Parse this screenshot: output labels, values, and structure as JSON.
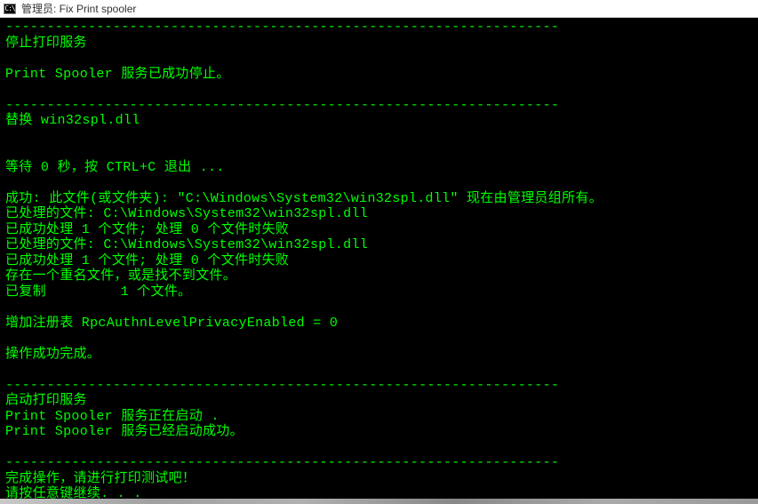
{
  "titlebar": {
    "icon_text": "C:\\",
    "title": "管理员:  Fix Print spooler"
  },
  "console": {
    "lines": [
      "-------------------------------------------------------------------",
      "停止打印服务",
      "",
      "Print Spooler 服务已成功停止。",
      "",
      "-------------------------------------------------------------------",
      "替换 win32spl.dll",
      "",
      "",
      "等待 0 秒，按 CTRL+C 退出 ...",
      "",
      "成功: 此文件(或文件夹): \"C:\\Windows\\System32\\win32spl.dll\" 现在由管理员组所有。",
      "已处理的文件: C:\\Windows\\System32\\win32spl.dll",
      "已成功处理 1 个文件; 处理 0 个文件时失败",
      "已处理的文件: C:\\Windows\\System32\\win32spl.dll",
      "已成功处理 1 个文件; 处理 0 个文件时失败",
      "存在一个重名文件，或是找不到文件。",
      "已复制         1 个文件。",
      "",
      "增加注册表 RpcAuthnLevelPrivacyEnabled = 0",
      "",
      "操作成功完成。",
      "",
      "-------------------------------------------------------------------",
      "启动打印服务",
      "Print Spooler 服务正在启动 .",
      "Print Spooler 服务已经启动成功。",
      "",
      "-------------------------------------------------------------------",
      "完成操作，请进行打印测试吧！",
      "请按任意键继续. . ."
    ]
  }
}
